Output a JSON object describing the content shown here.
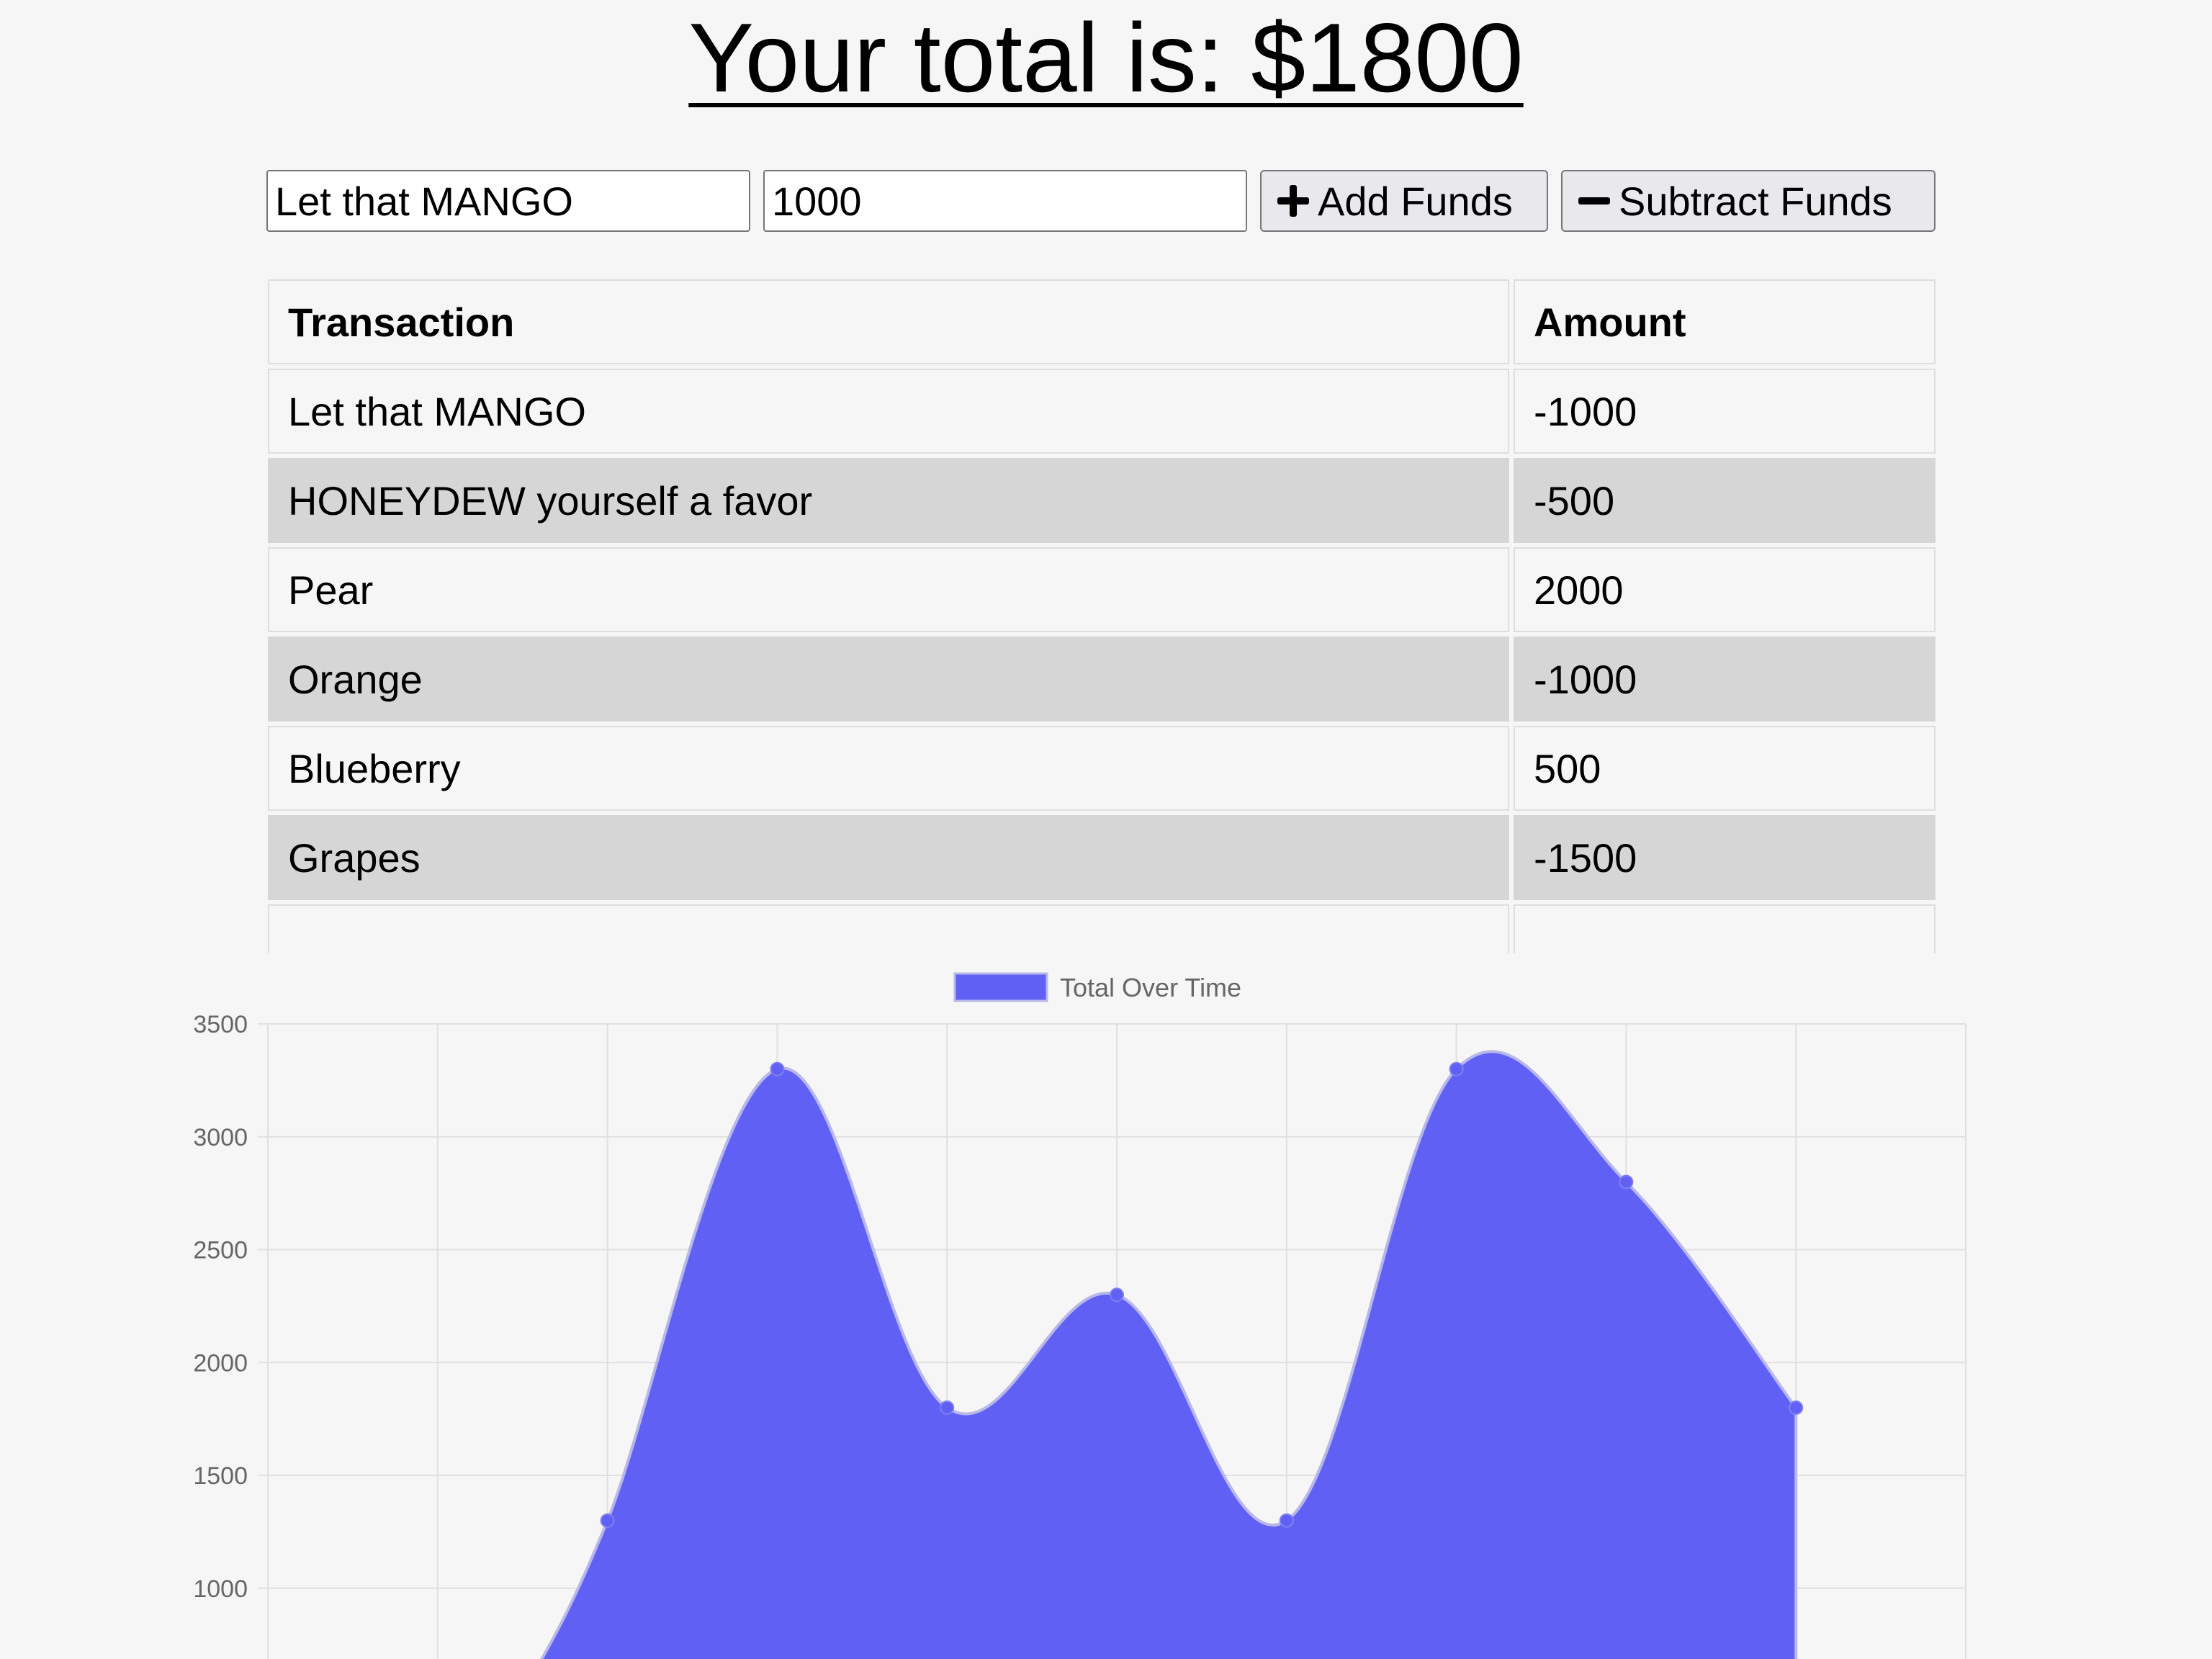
{
  "header": {
    "title": "Your total is: $1800"
  },
  "form": {
    "name_value": "Let that MANGO",
    "amount_value": "1000",
    "add_label": "Add Funds",
    "subtract_label": "Subtract Funds",
    "add_icon": "plus-icon",
    "subtract_icon": "minus-icon"
  },
  "table": {
    "headers": [
      "Transaction",
      "Amount"
    ],
    "rows": [
      {
        "name": "Let that MANGO",
        "amount": "-1000"
      },
      {
        "name": "HONEYDEW yourself a favor",
        "amount": "-500"
      },
      {
        "name": "Pear",
        "amount": "2000"
      },
      {
        "name": "Orange",
        "amount": "-1000"
      },
      {
        "name": "Blueberry",
        "amount": "500"
      },
      {
        "name": "Grapes",
        "amount": "-1500"
      }
    ]
  },
  "chart_data": {
    "type": "area",
    "title": "",
    "legend": {
      "label": "Total Over Time",
      "placement": "top-center"
    },
    "series": [
      {
        "name": "Total Over Time",
        "color": "#6060f5",
        "values": [
          null,
          null,
          1300,
          3300,
          1800,
          2300,
          1300,
          3300,
          2800,
          1800
        ]
      }
    ],
    "y_ticks": [
      1000,
      1500,
      2000,
      2500,
      3000,
      3500
    ],
    "ylim": [
      500,
      3500
    ],
    "grid": true,
    "x_points": 11
  }
}
